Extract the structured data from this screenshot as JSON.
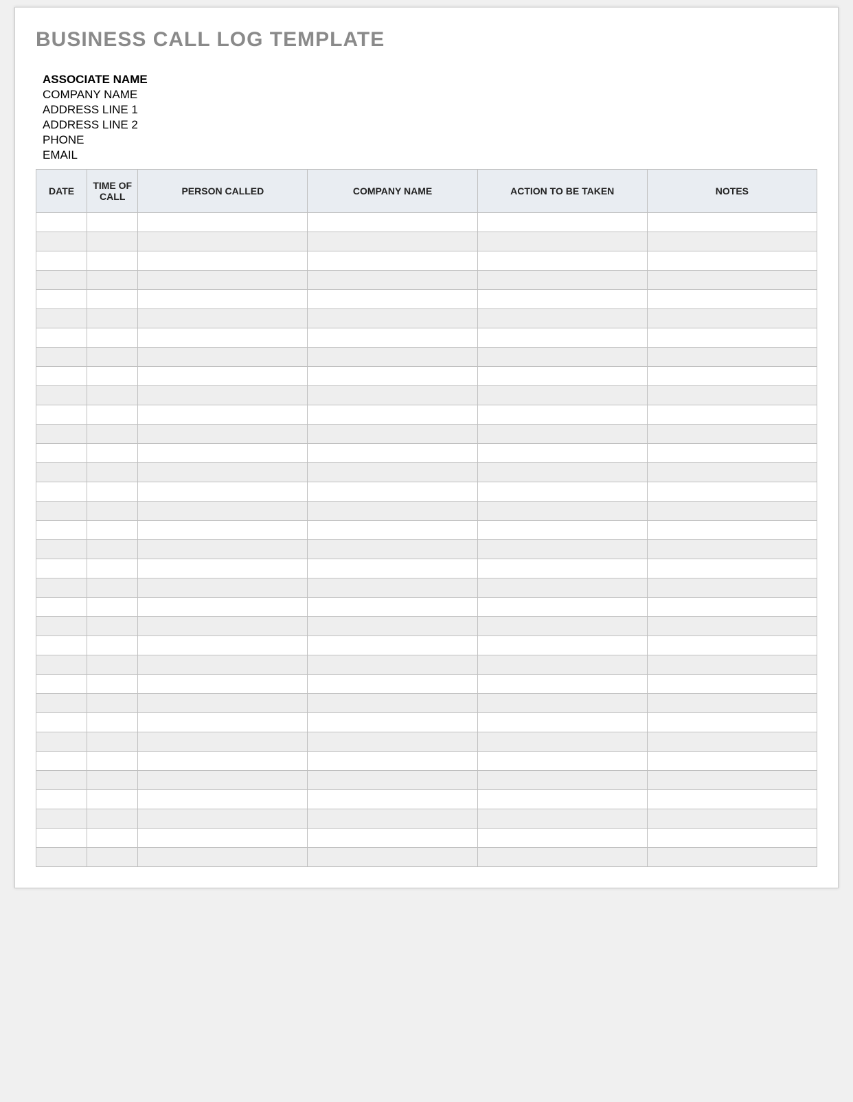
{
  "title": "BUSINESS CALL LOG TEMPLATE",
  "info": {
    "associate": "ASSOCIATE NAME",
    "company": "COMPANY NAME",
    "address1": "ADDRESS LINE 1",
    "address2": "ADDRESS LINE 2",
    "phone": "PHONE",
    "email": "EMAIL"
  },
  "columns": {
    "date": "DATE",
    "time": "TIME OF CALL",
    "person": "PERSON CALLED",
    "company": "COMPANY NAME",
    "action": "ACTION TO BE TAKEN",
    "notes": "NOTES"
  },
  "row_count": 34
}
